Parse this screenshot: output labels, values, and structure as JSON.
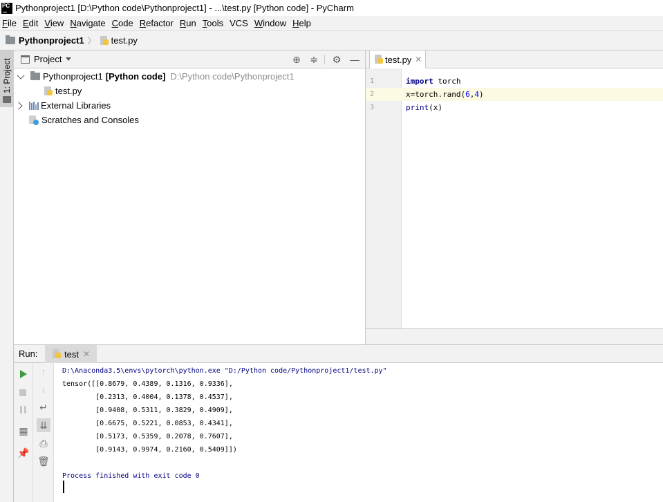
{
  "window": {
    "title": "Pythonproject1 [D:\\Python code\\Pythonproject1] - ...\\test.py [Python code] - PyCharm",
    "logo_text": "PC"
  },
  "menu": {
    "items": [
      {
        "label": "File",
        "mnemonic": "F",
        "rest": "ile"
      },
      {
        "label": "Edit",
        "mnemonic": "E",
        "rest": "dit"
      },
      {
        "label": "View",
        "mnemonic": "V",
        "rest": "iew"
      },
      {
        "label": "Navigate",
        "mnemonic": "N",
        "rest": "avigate"
      },
      {
        "label": "Code",
        "mnemonic": "C",
        "rest": "ode"
      },
      {
        "label": "Refactor",
        "mnemonic": "R",
        "rest": "efactor"
      },
      {
        "label": "Run",
        "mnemonic": "R",
        "rest": "un",
        "pre": ""
      },
      {
        "label": "Tools",
        "mnemonic": "T",
        "rest": "ools"
      },
      {
        "label": "VCS",
        "mnemonic": "",
        "rest": "VCS"
      },
      {
        "label": "Window",
        "mnemonic": "W",
        "rest": "indow"
      },
      {
        "label": "Help",
        "mnemonic": "H",
        "rest": "elp"
      }
    ]
  },
  "navbar": {
    "project": "Pythonproject1",
    "file": "test.py"
  },
  "left_strip": {
    "project_tab": "1: Project"
  },
  "project_panel": {
    "title": "Project",
    "tree": {
      "root_name": "Pythonproject1",
      "root_tag": "[Python code]",
      "root_path": "D:\\Python code\\Pythonproject1",
      "file": "test.py",
      "external_libraries": "External Libraries",
      "scratches": "Scratches and Consoles"
    }
  },
  "editor": {
    "tab_label": "test.py",
    "lines": [
      {
        "num": "1",
        "parts": [
          {
            "t": "import",
            "c": "kw"
          },
          {
            "t": " torch",
            "c": ""
          }
        ]
      },
      {
        "num": "2",
        "current": true,
        "parts": [
          {
            "t": "x=torch.rand(",
            "c": ""
          },
          {
            "t": "6",
            "c": "num"
          },
          {
            "t": ",",
            "c": ""
          },
          {
            "t": "4",
            "c": "num"
          },
          {
            "t": ")",
            "c": ""
          }
        ]
      },
      {
        "num": "3",
        "parts": [
          {
            "t": "print",
            "c": "bi"
          },
          {
            "t": "(x)",
            "c": ""
          }
        ]
      }
    ]
  },
  "run_panel": {
    "label": "Run:",
    "tab_label": "test",
    "console": [
      {
        "text": "D:\\Anaconda3.5\\envs\\pytorch\\python.exe \"D:/Python code/Pythonproject1/test.py\"",
        "kind": "cmd"
      },
      {
        "text": "tensor([[0.8679, 0.4389, 0.1316, 0.9336],",
        "kind": "out"
      },
      {
        "text": "        [0.2313, 0.4004, 0.1378, 0.4537],",
        "kind": "out"
      },
      {
        "text": "        [0.9408, 0.5311, 0.3829, 0.4909],",
        "kind": "out"
      },
      {
        "text": "        [0.6675, 0.5221, 0.0853, 0.4341],",
        "kind": "out"
      },
      {
        "text": "        [0.5173, 0.5359, 0.2078, 0.7607],",
        "kind": "out"
      },
      {
        "text": "        [0.9143, 0.9974, 0.2160, 0.5409]])",
        "kind": "out"
      },
      {
        "text": "",
        "kind": "out"
      },
      {
        "text": "Process finished with exit code 0",
        "kind": "exit"
      }
    ]
  },
  "colors": {
    "keyword": "#000080",
    "number": "#0000ff",
    "current_line": "#fcfae2",
    "run_green": "#3f9b3f"
  }
}
